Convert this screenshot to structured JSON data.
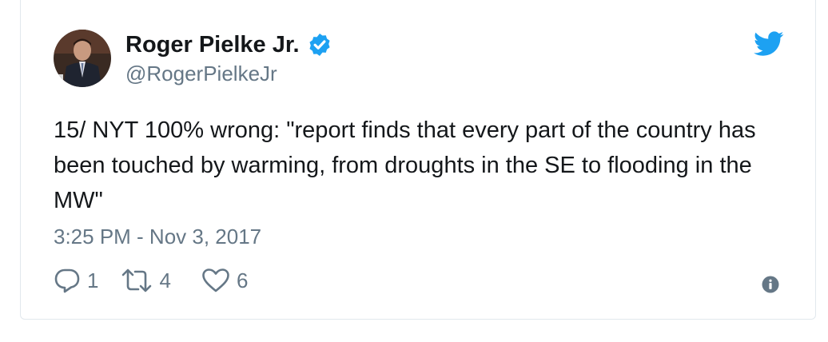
{
  "author": {
    "display_name": "Roger Pielke Jr.",
    "handle": "@RogerPielkeJr",
    "verified": true
  },
  "tweet": {
    "text": "15/ NYT 100% wrong: \"report finds that every part of the country has been touched by warming, from droughts in the SE to flooding in the MW\"",
    "timestamp": "3:25 PM - Nov 3, 2017"
  },
  "actions": {
    "replies": "1",
    "retweets": "4",
    "likes": "6"
  },
  "icons": {
    "reply": "reply-icon",
    "retweet": "retweet-icon",
    "like": "heart-icon",
    "info": "info-icon",
    "brand": "twitter-bird-icon",
    "verified": "verified-badge-icon"
  },
  "colors": {
    "brand_blue": "#1da1f2",
    "text": "#14171a",
    "secondary": "#657786",
    "border": "#e1e8ed"
  }
}
